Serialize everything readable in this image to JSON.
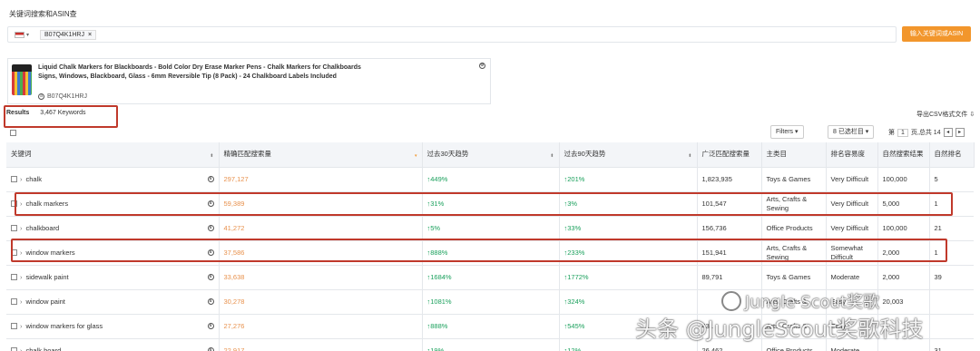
{
  "header": {
    "title": "关键词搜索和ASIN查"
  },
  "search": {
    "marketplace_flag": "us-flag-icon",
    "chip_value": "B07Q4K1HRJ",
    "chip_remove": "×",
    "submit_label": "输入关键词或ASIN"
  },
  "product": {
    "title": "Liquid Chalk Markers for Blackboards - Bold Color Dry Erase Marker Pens - Chalk Markers for Chalkboards Signs, Windows, Blackboard, Glass - 6mm Reversible Tip (8 Pack) - 24 Chalkboard Labels Included",
    "asin": "B07Q4K1HRJ"
  },
  "results": {
    "label": "Results",
    "count": "3,467 Keywords"
  },
  "export_label": "导出CSV格式文件",
  "toolbar": {
    "filters_label": "Filters",
    "columns_label": "8 已选栏目",
    "page_prefix": "第",
    "page_value": "1",
    "page_suffix": "页,总共 14"
  },
  "table": {
    "headers": [
      "关键词",
      "精确匹配搜索量",
      "过去30天趋势",
      "过去90天趋势",
      "广泛匹配搜索量",
      "主类目",
      "排名容易度",
      "自然搜索结果",
      "自然排名"
    ],
    "rows": [
      {
        "keyword": "chalk",
        "exact": "297,127",
        "t30": "↑449%",
        "t90": "↑201%",
        "broad": "1,823,935",
        "category": "Toys & Games",
        "ease": "Very Difficult",
        "organic": "100,000",
        "rank": "5"
      },
      {
        "keyword": "chalk markers",
        "exact": "59,389",
        "t30": "↑31%",
        "t90": "↑3%",
        "broad": "101,547",
        "category": "Arts, Crafts & Sewing",
        "ease": "Very Difficult",
        "organic": "5,000",
        "rank": "1"
      },
      {
        "keyword": "chalkboard",
        "exact": "41,272",
        "t30": "↑5%",
        "t90": "↑33%",
        "broad": "156,736",
        "category": "Office Products",
        "ease": "Very Difficult",
        "organic": "100,000",
        "rank": "21"
      },
      {
        "keyword": "window markers",
        "exact": "37,586",
        "t30": "↑888%",
        "t90": "↑233%",
        "broad": "151,941",
        "category": "Arts, Crafts & Sewing",
        "ease": "Somewhat Difficult",
        "organic": "2,000",
        "rank": "1"
      },
      {
        "keyword": "sidewalk paint",
        "exact": "33,638",
        "t30": "↑1684%",
        "t90": "↑1772%",
        "broad": "89,791",
        "category": "Toys & Games",
        "ease": "Moderate",
        "organic": "2,000",
        "rank": "39"
      },
      {
        "keyword": "window paint",
        "exact": "30,278",
        "t30": "↑1081%",
        "t90": "↑324%",
        "broad": "",
        "category": "Arts, Crafts &",
        "ease": "Easy",
        "organic": "20,003",
        "rank": ""
      },
      {
        "keyword": "window markers for glass",
        "exact": "27,276",
        "t30": "↑888%",
        "t90": "↑545%",
        "broad": "431",
        "category": "Arts, Crafts &",
        "ease": "Easy",
        "organic": "",
        "rank": ""
      },
      {
        "keyword": "chalk board",
        "exact": "22,917",
        "t30": "↑19%",
        "t90": "↑12%",
        "broad": "26,462",
        "category": "Office Products",
        "ease": "Moderate",
        "organic": "",
        "rank": "31"
      }
    ]
  },
  "watermarks": {
    "small": "Jungle Scout奖歌",
    "big": "头条 @JungleScout奖歌科技"
  },
  "colors": {
    "accent": "#f2962c",
    "trend_up": "#1aa05c",
    "highlight": "#c0392b"
  }
}
